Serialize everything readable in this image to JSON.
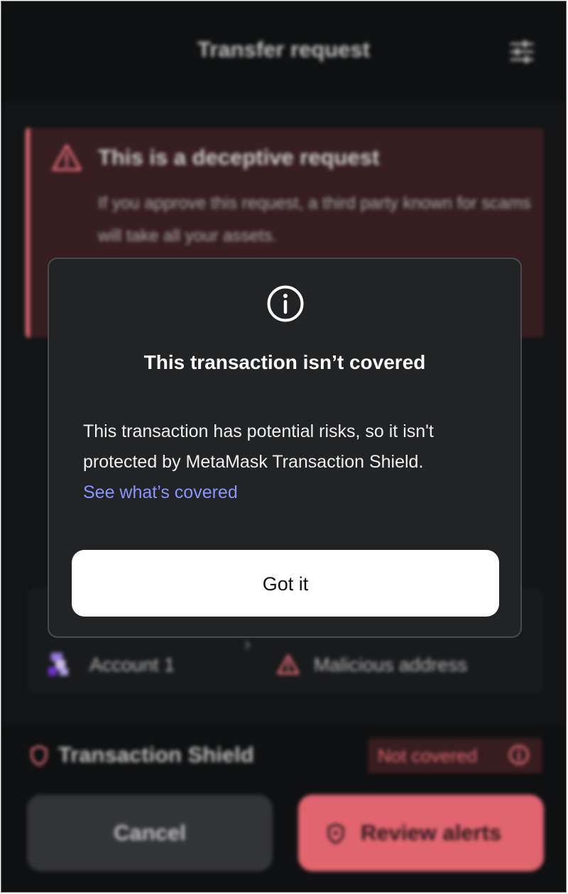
{
  "header": {
    "title": "Transfer request",
    "settings_icon": "sliders-icon"
  },
  "alert": {
    "title": "This is a deceptive request",
    "text": "If you approve this request, a third party known for scams will take all your assets.",
    "icon": "warning-triangle-icon",
    "color": "#ff7a85"
  },
  "accounts": {
    "from_label": "Account 1",
    "to_label": "Malicious address"
  },
  "shield_row": {
    "label": "Transaction Shield",
    "badge": "Not covered"
  },
  "footer": {
    "cancel_label": "Cancel",
    "review_label": "Review alerts"
  },
  "modal": {
    "title": "This transaction isn’t covered",
    "body": "This transaction has potential risks, so it isn't protected by MetaMask Transaction Shield.",
    "link_label": "See what’s covered",
    "button_label": "Got it",
    "link_color": "#8b93ff"
  }
}
